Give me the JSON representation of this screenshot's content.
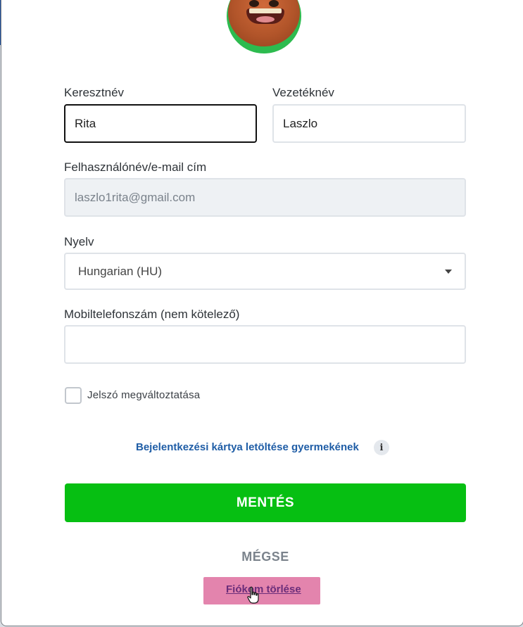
{
  "form": {
    "first_name": {
      "label": "Keresztnév",
      "value": "Rita"
    },
    "last_name": {
      "label": "Vezetéknév",
      "value": "Laszlo"
    },
    "username": {
      "label": "Felhasználónév/e-mail cím",
      "value": "laszlo1rita@gmail.com"
    },
    "language": {
      "label": "Nyelv",
      "selected": "Hungarian (HU)"
    },
    "phone": {
      "label": "Mobiltelefonszám (nem kötelező)",
      "value": ""
    },
    "change_password": {
      "label": "Jelszó megváltoztatása",
      "checked": false
    }
  },
  "links": {
    "download_card": "Bejelentkezési kártya letöltése gyermekének",
    "info_glyph": "i",
    "delete_account": "Fiókom törlése"
  },
  "buttons": {
    "save": "MENTÉS",
    "cancel": "MÉGSE"
  },
  "colors": {
    "save_button": "#06bf12",
    "link": "#1f5da6",
    "highlight": "#e384ad"
  },
  "icons": {
    "avatar": "bigfoot-monster-avatar",
    "info": "info-icon",
    "dropdown": "caret-down-icon",
    "cursor": "hand-pointer-cursor-icon"
  }
}
